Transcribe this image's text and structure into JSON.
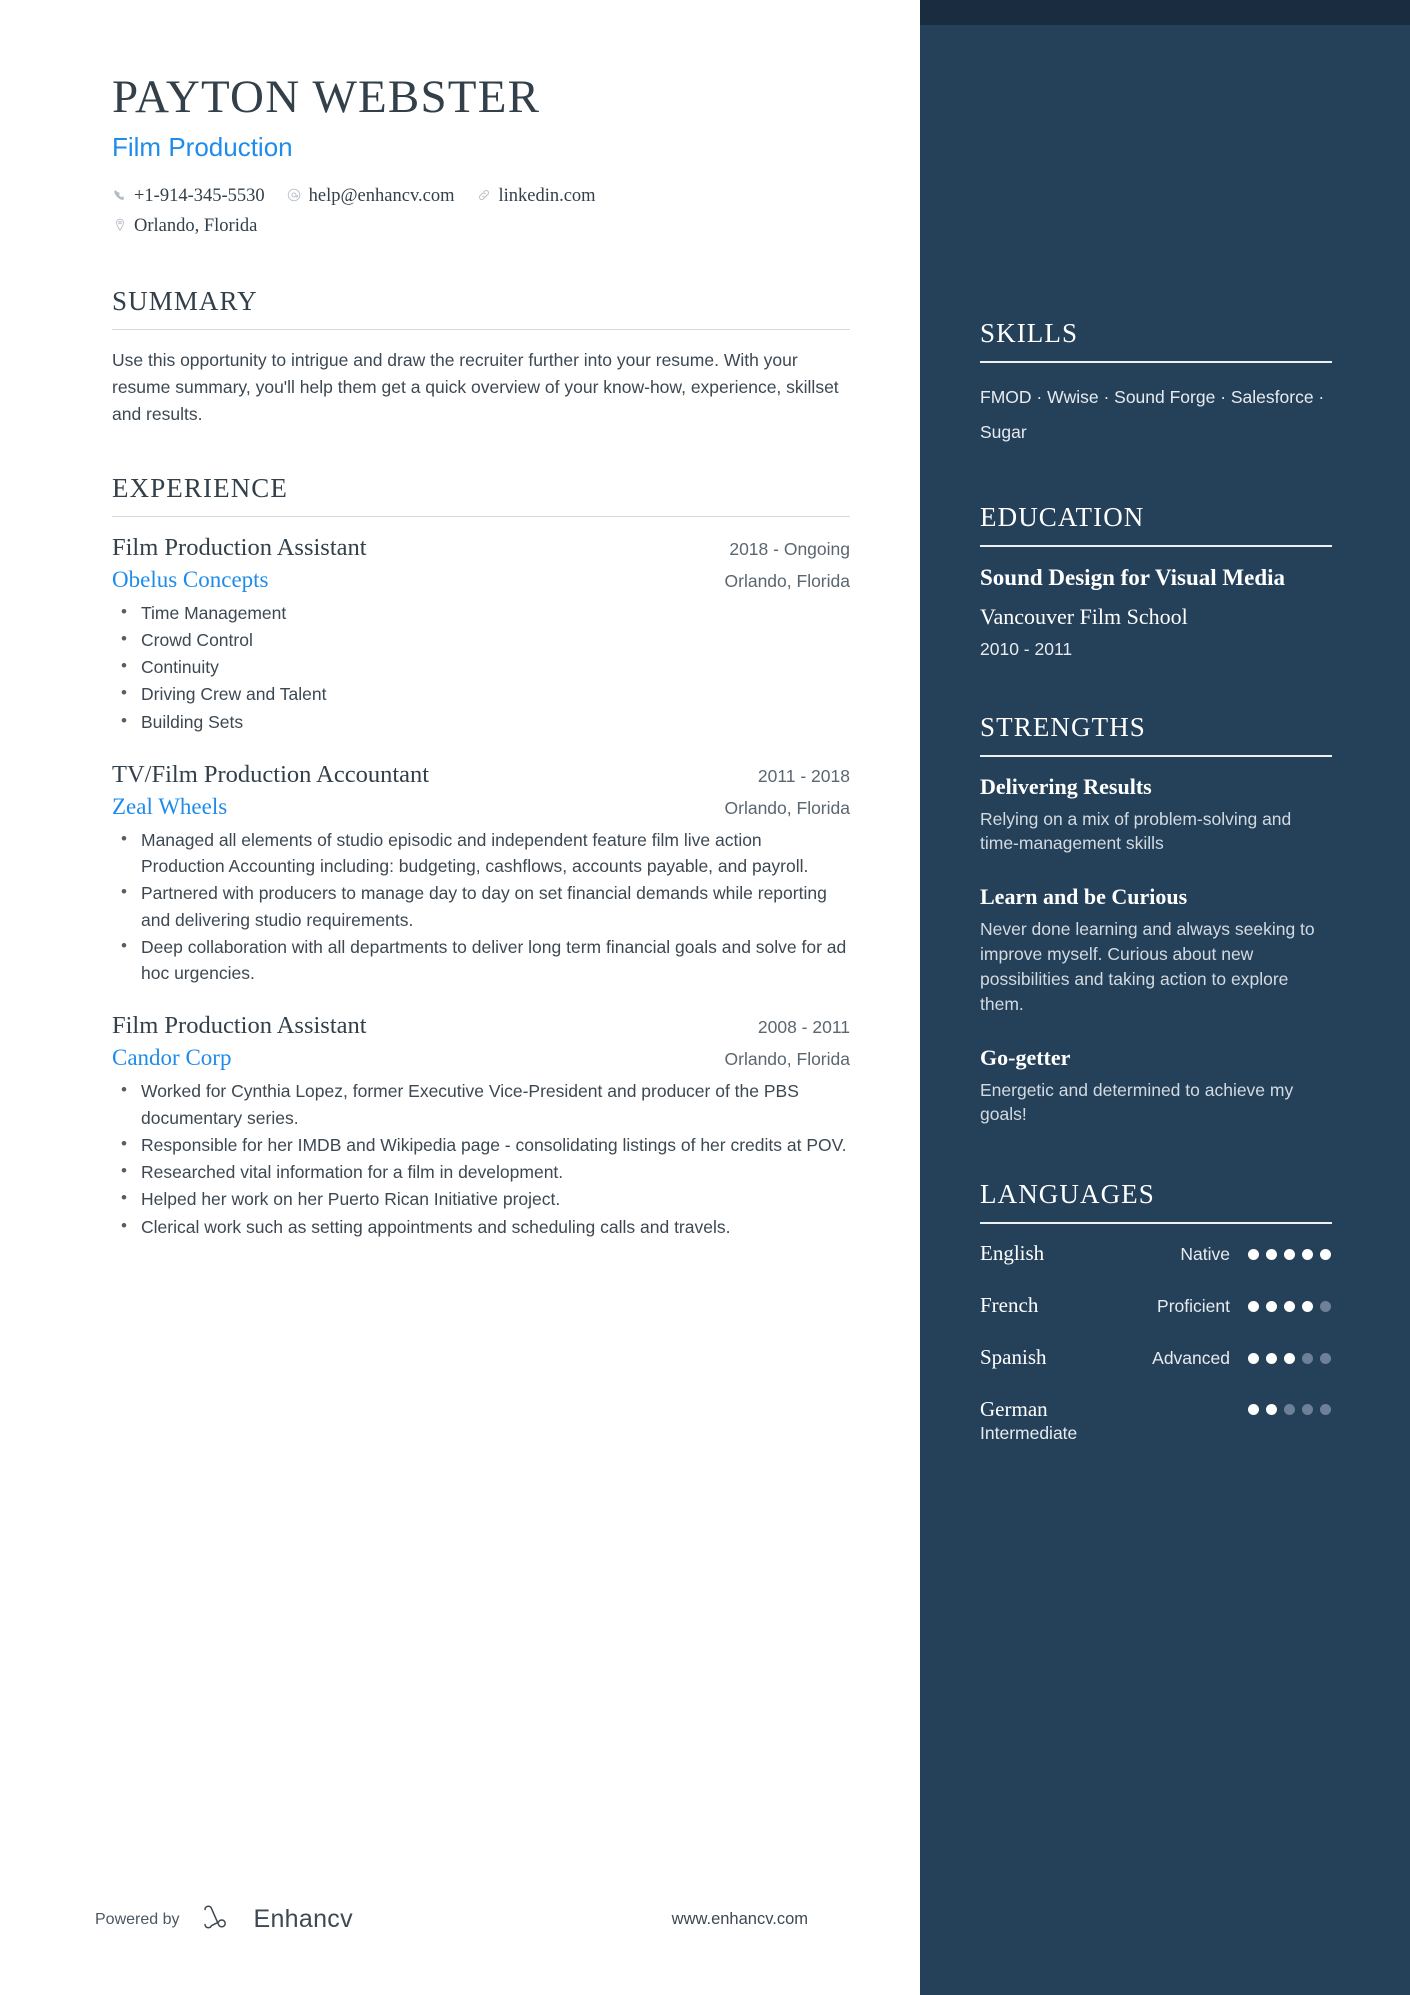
{
  "header": {
    "name": "PAYTON WEBSTER",
    "role": "Film Production",
    "contacts": [
      {
        "icon": "phone-icon",
        "glyph": "✆",
        "text": "+1-914-345-5530"
      },
      {
        "icon": "email-icon",
        "glyph": "@",
        "text": "help@enhancv.com"
      },
      {
        "icon": "link-icon",
        "glyph": "ὑ7",
        "text": "linkedin.com"
      },
      {
        "icon": "location-pin-icon",
        "glyph": "◎",
        "text": "Orlando, Florida"
      }
    ]
  },
  "summary": {
    "title": "SUMMARY",
    "text": "Use this opportunity to intrigue and draw the recruiter further into your resume. With your resume summary, you'll help them get a quick overview of your know-how, experience, skillset and results."
  },
  "experience": {
    "title": "EXPERIENCE",
    "jobs": [
      {
        "title": "Film Production Assistant",
        "dates": "2018 - Ongoing",
        "company": "Obelus Concepts",
        "location": "Orlando, Florida",
        "bullets": [
          "Time Management",
          "Crowd Control",
          "Continuity",
          "Driving Crew and Talent",
          "Building Sets"
        ]
      },
      {
        "title": "TV/Film Production Accountant",
        "dates": "2011 - 2018",
        "company": "Zeal Wheels",
        "location": "Orlando, Florida",
        "bullets": [
          "Managed all elements of studio episodic and independent feature film live action Production Accounting including: budgeting, cashflows, accounts payable, and payroll.",
          "Partnered with producers to manage day to day on set financial demands while reporting and delivering studio requirements.",
          "Deep collaboration with all departments to deliver long term financial goals and solve for ad hoc urgencies."
        ]
      },
      {
        "title": "Film Production Assistant",
        "dates": "2008 - 2011",
        "company": "Candor Corp",
        "location": "Orlando, Florida",
        "bullets": [
          "Worked for Cynthia Lopez, former Executive Vice-President and producer of the PBS documentary series.",
          "Responsible for her IMDB and Wikipedia page - consolidating listings of her credits at POV.",
          "Researched vital information for a film in development.",
          "Helped her work on her Puerto Rican Initiative project.",
          "Clerical work such as setting appointments and scheduling calls and travels."
        ]
      }
    ]
  },
  "skills": {
    "title": "SKILLS",
    "text": "FMOD · Wwise · Sound Forge · Salesforce · Sugar"
  },
  "education": {
    "title": "EDUCATION",
    "degree": "Sound Design for Visual Media",
    "school": "Vancouver Film School",
    "dates": "2010 - 2011"
  },
  "strengths": {
    "title": "STRENGTHS",
    "items": [
      {
        "name": "Delivering Results",
        "description": "Relying on a mix of problem-solving and time-management skills"
      },
      {
        "name": "Learn and be Curious",
        "description": "Never done learning and always seeking to improve myself. Curious about new possibilities and taking action to explore them."
      },
      {
        "name": "Go-getter",
        "description": "Energetic and determined to achieve my goals!"
      }
    ]
  },
  "languages": {
    "title": "LANGUAGES",
    "max_dots": 5,
    "items": [
      {
        "name": "English",
        "level": "Native",
        "rating": 5
      },
      {
        "name": "French",
        "level": "Proficient",
        "rating": 4
      },
      {
        "name": "Spanish",
        "level": "Advanced",
        "rating": 3
      },
      {
        "name": "German",
        "level": "Intermediate",
        "rating": 2
      }
    ]
  },
  "footer": {
    "powered_by": "Powered by",
    "brand": "Enhancv",
    "url": "www.enhancv.com"
  },
  "colors": {
    "accent_blue": "#1f8ceb",
    "sidebar_navy": "#254059",
    "sidebar_cap_navy": "#1a2c40",
    "heading_dark": "#33404a"
  }
}
